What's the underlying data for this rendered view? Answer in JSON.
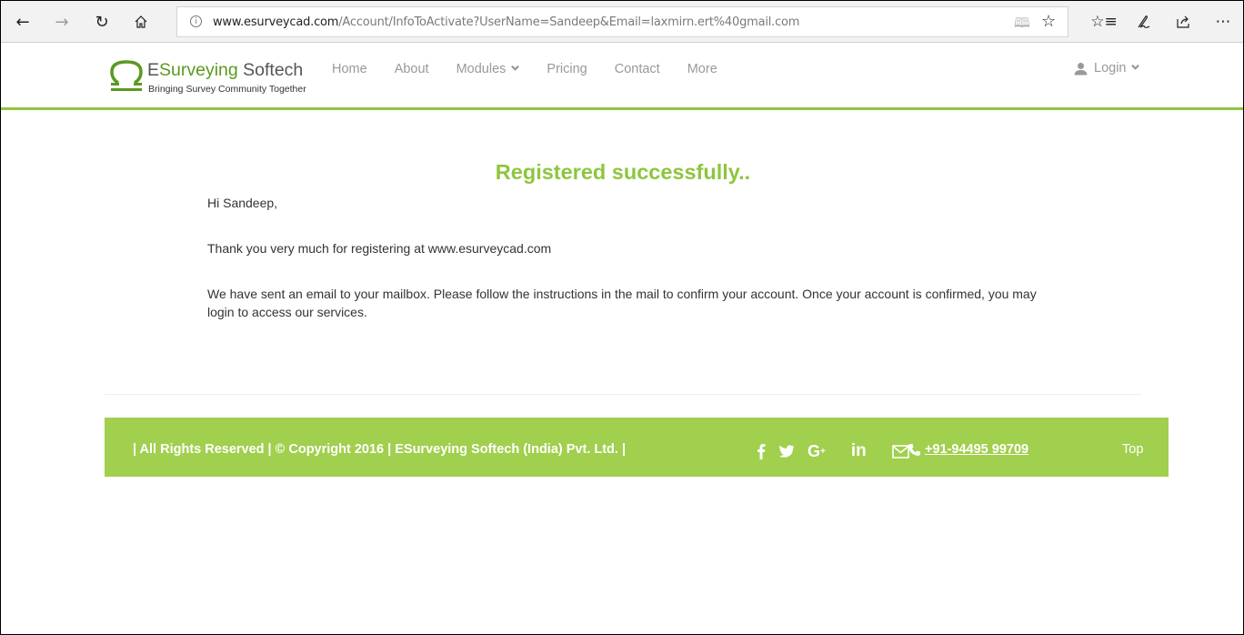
{
  "browser": {
    "back_icon": "arrow-left-icon",
    "forward_icon": "arrow-right-icon",
    "refresh_icon": "refresh-icon",
    "home_icon": "home-icon",
    "url_domain": "www.esurveycad.com",
    "url_path": "/Account/InfoToActivate?UserName=Sandeep&Email=laxmirn.ert%40gmail.com",
    "toolbar_icons": [
      "reading-view-icon",
      "favorite-star-icon",
      "favorites-list-icon",
      "pen-icon",
      "share-icon",
      "more-icon"
    ]
  },
  "header": {
    "logo_title_prefix": "E",
    "logo_title_green": "Surveying",
    "logo_title_suffix": " Softech",
    "logo_tagline": "Bringing Survey Community Together",
    "nav": [
      {
        "label": "Home"
      },
      {
        "label": "About"
      },
      {
        "label": "Modules",
        "has_dropdown": true
      },
      {
        "label": "Pricing"
      },
      {
        "label": "Contact"
      },
      {
        "label": "More"
      }
    ],
    "login_label": "Login",
    "accent_color": "#8dc63f"
  },
  "main": {
    "heading": "Registered successfully..",
    "greeting": "Hi Sandeep,",
    "thanks": "Thank you very much for registering at www.esurveycad.com",
    "instructions": "We have sent an email to your mailbox. Please follow the instructions in the mail to confirm your account. Once your account is confirmed, you may login to access our services."
  },
  "footer": {
    "copyright": "| All Rights Reserved | © Copyright 2016 | ESurveying Softech (India) Pvt. Ltd. |",
    "social": [
      "facebook-icon",
      "twitter-icon",
      "google-plus-icon",
      "linkedin-icon",
      "email-icon"
    ],
    "phone": "+91-94495 99709",
    "top_label": "Top",
    "background_color": "#a1cf4e"
  }
}
